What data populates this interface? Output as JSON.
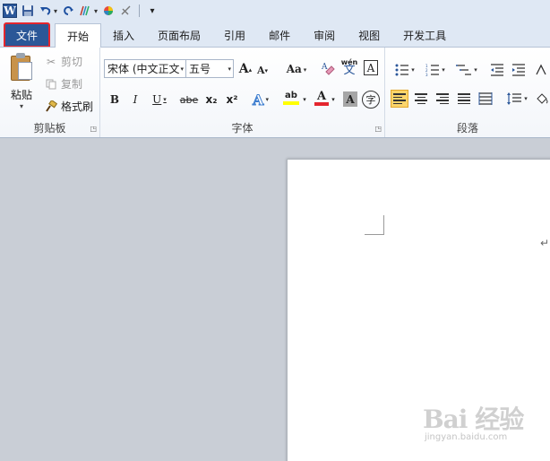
{
  "quick_access": {
    "word_icon": "W",
    "items": [
      "save-icon",
      "undo-icon",
      "redo-icon",
      "format-painter-icon",
      "color-wheel-icon",
      "erase-icon",
      "customize-icon"
    ]
  },
  "tabs": {
    "file": "文件",
    "home": "开始",
    "insert": "插入",
    "page_layout": "页面布局",
    "references": "引用",
    "mailings": "邮件",
    "review": "审阅",
    "view": "视图",
    "developer": "开发工具"
  },
  "clipboard": {
    "paste": "粘贴",
    "cut": "剪切",
    "copy": "复制",
    "format_painter": "格式刷",
    "group_label": "剪贴板"
  },
  "font": {
    "font_name": "宋体 (中文正文",
    "font_size": "五号",
    "group_label": "字体",
    "grow": "A",
    "shrink": "A",
    "change_case": "Aa",
    "pinyin_top": "wén",
    "pinyin_char": "文",
    "border_char": "A",
    "bold": "B",
    "italic": "I",
    "underline": "U",
    "strike": "abe",
    "subscript": "x₂",
    "superscript": "x²",
    "highlight": "ab",
    "font_color": "A",
    "char_shading": "A",
    "enclose": "字"
  },
  "paragraph": {
    "group_label": "段落"
  },
  "document": {
    "paragraph_mark": "↵"
  },
  "watermark": {
    "text": "Bai 经验",
    "url": "jingyan.baidu.com"
  },
  "colors": {
    "file_tab": "#2b5797",
    "highlight_outline": "#e4262e",
    "ribbon_bg": "#ffffff",
    "active_align": "#fbd56b",
    "font_color_bar": "#e4262e",
    "highlight_bar": "#ffff00"
  }
}
